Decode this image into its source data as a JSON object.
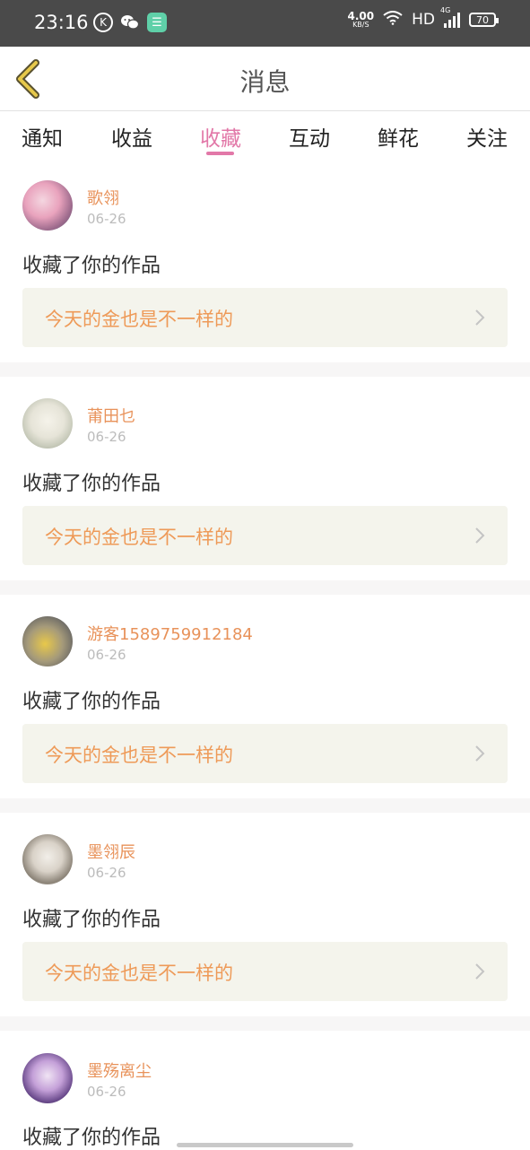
{
  "status_bar": {
    "time": "23:16",
    "k_icon_label": "K",
    "net_speed_value": "4.00",
    "net_speed_unit": "KB/S",
    "hd_label": "HD",
    "network_type": "4G",
    "battery_level": "70"
  },
  "header": {
    "title": "消息",
    "back_icon": "chevron-left-icon",
    "accent_color": "#e6c84a"
  },
  "tabs": [
    {
      "label": "通知"
    },
    {
      "label": "收益"
    },
    {
      "label": "收藏"
    },
    {
      "label": "互动"
    },
    {
      "label": "鲜花"
    },
    {
      "label": "关注"
    }
  ],
  "active_tab": "收藏",
  "colors": {
    "active_tab": "#e278a8",
    "username": "#e8925a",
    "work_title": "#ee9a58",
    "work_box_bg": "#f4f4ec"
  },
  "messages": [
    {
      "username": "歌翎",
      "date": "06-26",
      "action": "收藏了你的作品",
      "work_title": "今天的金也是不一样的"
    },
    {
      "username": "莆田乜",
      "date": "06-26",
      "action": "收藏了你的作品",
      "work_title": "今天的金也是不一样的"
    },
    {
      "username": "游客1589759912184",
      "date": "06-26",
      "action": "收藏了你的作品",
      "work_title": "今天的金也是不一样的"
    },
    {
      "username": "墨翎辰",
      "date": "06-26",
      "action": "收藏了你的作品",
      "work_title": "今天的金也是不一样的"
    },
    {
      "username": "墨殇离尘",
      "date": "06-26",
      "action": "收藏了你的作品",
      "work_title": ""
    }
  ]
}
